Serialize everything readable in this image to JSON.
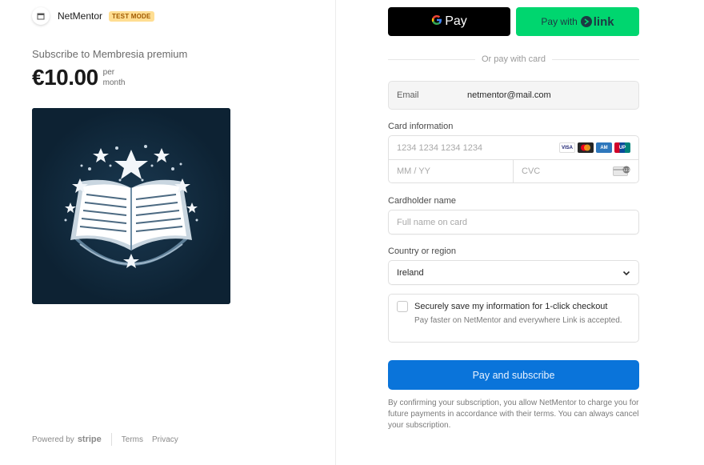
{
  "merchant": {
    "name": "NetMentor",
    "badge": "TEST MODE"
  },
  "summary": {
    "title": "Subscribe to Membresia premium",
    "price": "€10.00",
    "period": "per month"
  },
  "footer": {
    "powered_by": "Powered by",
    "stripe": "stripe",
    "terms": "Terms",
    "privacy": "Privacy"
  },
  "wallets": {
    "gpay_label": "Pay",
    "link_prefix": "Pay with",
    "link_word": "link"
  },
  "divider_text": "Or pay with card",
  "email": {
    "label": "Email",
    "value": "netmentor@mail.com"
  },
  "card": {
    "label": "Card information",
    "number_placeholder": "1234 1234 1234 1234",
    "expiry_placeholder": "MM / YY",
    "cvc_placeholder": "CVC",
    "brands": [
      "visa",
      "mastercard",
      "amex",
      "unionpay"
    ]
  },
  "cardholder": {
    "label": "Cardholder name",
    "placeholder": "Full name on card"
  },
  "country": {
    "label": "Country or region",
    "value": "Ireland"
  },
  "save_info": {
    "title": "Securely save my information for 1-click checkout",
    "description": "Pay faster on NetMentor and everywhere Link is accepted."
  },
  "submit_label": "Pay and subscribe",
  "terms_text": "By confirming your subscription, you allow NetMentor to charge you for future payments in accordance with their terms. You can always cancel your subscription.",
  "colors": {
    "pay_button": "#0a74da",
    "link_green": "#00d66f",
    "test_badge": "#ffde92",
    "product_bg": "#0d2233"
  }
}
